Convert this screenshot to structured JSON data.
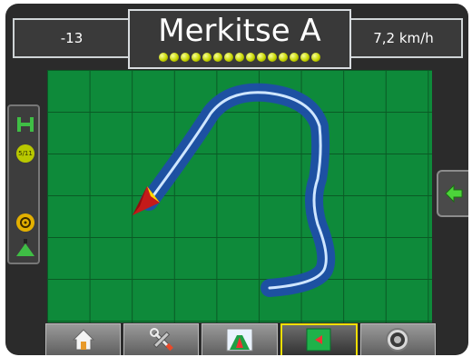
{
  "header": {
    "left_value": "-13",
    "title": "Merkitse A",
    "speed": "7,2 km/h",
    "led_count": 15
  },
  "left_panel": {
    "icons": [
      "boom-icon",
      "section-count-icon",
      "steering-icon",
      "spray-nozzle-icon"
    ],
    "section_count_label": "5/11"
  },
  "right_tab": {
    "icon": "arrow-left-icon"
  },
  "bottom_tabs": [
    {
      "icon": "home-icon",
      "active": false
    },
    {
      "icon": "tools-icon",
      "active": false
    },
    {
      "icon": "guidance-view-icon",
      "active": false
    },
    {
      "icon": "map-view-icon",
      "active": true
    },
    {
      "icon": "gauge-icon",
      "active": false
    }
  ],
  "colors": {
    "map_green": "#0e8a3a",
    "path_blue": "#1f4ea8",
    "path_line": "#cfe6ff",
    "vehicle_red": "#c41a1a",
    "led_yellow": "#d2e000",
    "active_tab_border": "#f2e000"
  }
}
